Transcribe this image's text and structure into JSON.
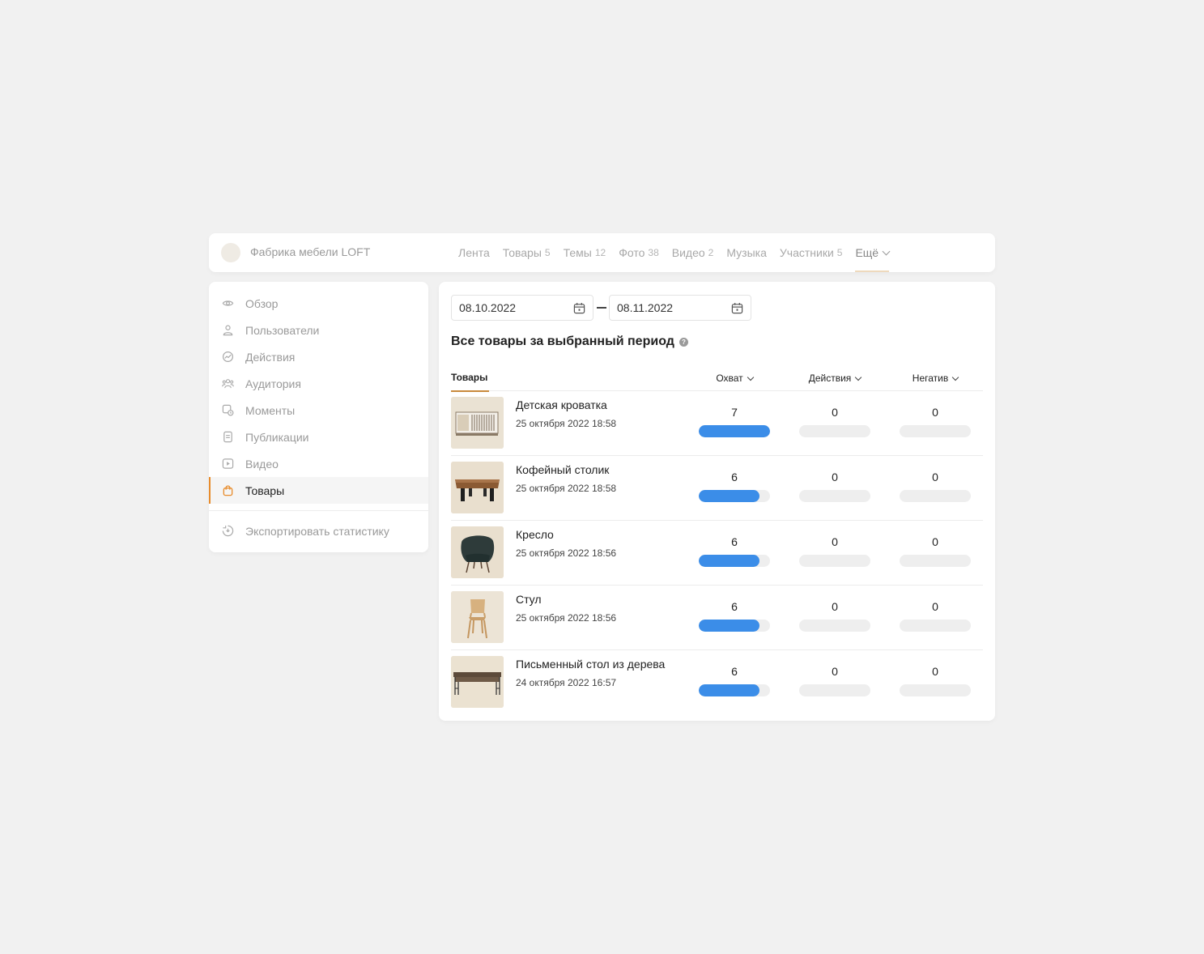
{
  "header": {
    "group_name": "Фабрика мебели LOFT",
    "tabs": [
      {
        "label": "Лента",
        "count": ""
      },
      {
        "label": "Товары",
        "count": "5"
      },
      {
        "label": "Темы",
        "count": "12"
      },
      {
        "label": "Фото",
        "count": "38"
      },
      {
        "label": "Видео",
        "count": "2"
      },
      {
        "label": "Музыка",
        "count": ""
      },
      {
        "label": "Участники",
        "count": "5"
      }
    ],
    "more_label": "Ещё"
  },
  "sidebar": {
    "items": [
      {
        "label": "Обзор",
        "icon": "eye-icon"
      },
      {
        "label": "Пользователи",
        "icon": "user-icon"
      },
      {
        "label": "Действия",
        "icon": "activity-icon"
      },
      {
        "label": "Аудитория",
        "icon": "audience-icon"
      },
      {
        "label": "Моменты",
        "icon": "moments-icon"
      },
      {
        "label": "Публикации",
        "icon": "document-icon"
      },
      {
        "label": "Видео",
        "icon": "video-icon"
      },
      {
        "label": "Товары",
        "icon": "shopping-bag-icon",
        "active": true
      }
    ],
    "export_label": "Экспортировать статистику",
    "accent_color": "#e88c2c"
  },
  "filters": {
    "date_from": "08.10.2022",
    "date_to": "08.11.2022"
  },
  "main": {
    "title": "Все товары за выбранный период",
    "help": "?"
  },
  "table": {
    "col_products": "Товары",
    "col_reach": "Охват",
    "col_actions": "Действия",
    "col_negative": "Негатив",
    "bar_color": "#3b8de8",
    "rows": [
      {
        "name": "Детская кроватка",
        "date": "25 октября 2022 18:58",
        "reach": "7",
        "actions": "0",
        "negative": "0",
        "reach_fill": 1.0,
        "thumb": "crib-image"
      },
      {
        "name": "Кофейный столик",
        "date": "25 октября 2022 18:58",
        "reach": "6",
        "actions": "0",
        "negative": "0",
        "reach_fill": 0.857,
        "thumb": "coffee-table-image"
      },
      {
        "name": "Кресло",
        "date": "25 октября 2022 18:56",
        "reach": "6",
        "actions": "0",
        "negative": "0",
        "reach_fill": 0.857,
        "thumb": "armchair-image"
      },
      {
        "name": "Стул",
        "date": "25 октября 2022 18:56",
        "reach": "6",
        "actions": "0",
        "negative": "0",
        "reach_fill": 0.857,
        "thumb": "chair-image"
      },
      {
        "name": "Письменный стол из дерева",
        "date": "24 октября 2022 16:57",
        "reach": "6",
        "actions": "0",
        "negative": "0",
        "reach_fill": 0.857,
        "thumb": "desk-image"
      }
    ]
  }
}
